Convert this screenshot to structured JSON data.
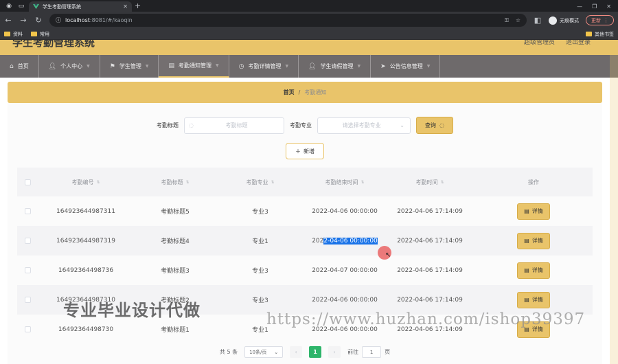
{
  "browser": {
    "tab_title": "学生考勤管理系统",
    "url_host": "localhost",
    "url_path": ":8081/#/kaoqin",
    "profile_label": "无痕模式",
    "update_label": "更新",
    "bookmarks": [
      "资料",
      "常用"
    ],
    "bookmarks_right": "其他书签"
  },
  "app": {
    "title": "学生考勤管理系统",
    "user_items": [
      "超级管理员",
      "退出登录"
    ]
  },
  "nav": [
    {
      "label": "首页",
      "icon": "home-icon"
    },
    {
      "label": "个人中心",
      "icon": "user-icon"
    },
    {
      "label": "学生管理",
      "icon": "flag-icon"
    },
    {
      "label": "考勤通知管理",
      "icon": "notice-icon"
    },
    {
      "label": "考勤详情管理",
      "icon": "clock-icon"
    },
    {
      "label": "学生请假管理",
      "icon": "person-icon"
    },
    {
      "label": "公告信息管理",
      "icon": "send-icon"
    }
  ],
  "breadcrumb": {
    "home": "首页",
    "sep": "/",
    "current": "考勤通知"
  },
  "search": {
    "title_label": "考勤标题",
    "title_placeholder": "考勤标题",
    "major_label": "考勤专业",
    "major_placeholder": "请选择考勤专业",
    "query_label": "查询",
    "add_label": "新增"
  },
  "table": {
    "headers": [
      "考勤编号",
      "考勤标题",
      "考勤专业",
      "考勤结束时间",
      "考勤时间",
      "操作"
    ],
    "detail_label": "详情",
    "rows": [
      {
        "id": "164923644987311",
        "title": "考勤标题5",
        "major": "专业3",
        "end": "2022-04-06 00:00:00",
        "time": "2022-04-06 17:14:09"
      },
      {
        "id": "164923644987319",
        "title": "考勤标题4",
        "major": "专业1",
        "end_pre": "202",
        "end_sel": "2-04-06 00:00:00",
        "time": "2022-04-06 17:14:09"
      },
      {
        "id": "16492364498736",
        "title": "考勤标题3",
        "major": "专业3",
        "end": "2022-04-07 00:00:00",
        "time": "2022-04-06 17:14:09"
      },
      {
        "id": "164923644987310",
        "title": "考勤标题2",
        "major": "专业3",
        "end": "2022-04-06 00:00:00",
        "time": "2022-04-06 17:14:09"
      },
      {
        "id": "16492364498730",
        "title": "考勤标题1",
        "major": "专业1",
        "end": "2022-04-06 00:00:00",
        "time": "2022-04-06 17:14:09"
      }
    ]
  },
  "pager": {
    "total": "共 5 条",
    "size": "10条/页",
    "current": "1",
    "goto_label": "前往",
    "goto_value": "1",
    "page_suffix": "页"
  },
  "watermarks": {
    "left": "专业毕业设计代做",
    "right": "https://www.huzhan.com/ishop39397"
  },
  "colors": {
    "accent": "#e9c46a",
    "nav": "#6e6a6b",
    "pager": "#2eb56a"
  }
}
